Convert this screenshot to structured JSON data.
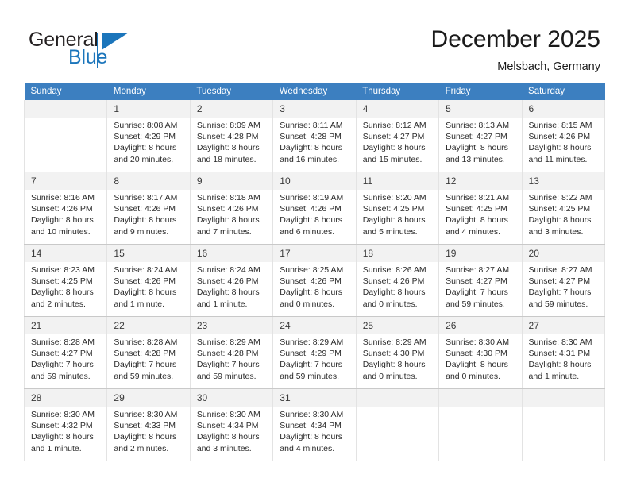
{
  "brand": {
    "name_top": "General",
    "name_bottom": "Blue",
    "accent_color": "#1b75bb",
    "text_color": "#231f20"
  },
  "header": {
    "title": "December 2025",
    "subtitle": "Melsbach, Germany",
    "header_bg_color": "#3c7fc0",
    "header_text_color": "#ffffff"
  },
  "weekday_headers": [
    "Sunday",
    "Monday",
    "Tuesday",
    "Wednesday",
    "Thursday",
    "Friday",
    "Saturday"
  ],
  "weeks": [
    [
      {
        "day": "",
        "sunrise": "",
        "sunset": "",
        "daylight_line1": "",
        "daylight_line2": ""
      },
      {
        "day": "1",
        "sunrise": "Sunrise: 8:08 AM",
        "sunset": "Sunset: 4:29 PM",
        "daylight_line1": "Daylight: 8 hours",
        "daylight_line2": "and 20 minutes."
      },
      {
        "day": "2",
        "sunrise": "Sunrise: 8:09 AM",
        "sunset": "Sunset: 4:28 PM",
        "daylight_line1": "Daylight: 8 hours",
        "daylight_line2": "and 18 minutes."
      },
      {
        "day": "3",
        "sunrise": "Sunrise: 8:11 AM",
        "sunset": "Sunset: 4:28 PM",
        "daylight_line1": "Daylight: 8 hours",
        "daylight_line2": "and 16 minutes."
      },
      {
        "day": "4",
        "sunrise": "Sunrise: 8:12 AM",
        "sunset": "Sunset: 4:27 PM",
        "daylight_line1": "Daylight: 8 hours",
        "daylight_line2": "and 15 minutes."
      },
      {
        "day": "5",
        "sunrise": "Sunrise: 8:13 AM",
        "sunset": "Sunset: 4:27 PM",
        "daylight_line1": "Daylight: 8 hours",
        "daylight_line2": "and 13 minutes."
      },
      {
        "day": "6",
        "sunrise": "Sunrise: 8:15 AM",
        "sunset": "Sunset: 4:26 PM",
        "daylight_line1": "Daylight: 8 hours",
        "daylight_line2": "and 11 minutes."
      }
    ],
    [
      {
        "day": "7",
        "sunrise": "Sunrise: 8:16 AM",
        "sunset": "Sunset: 4:26 PM",
        "daylight_line1": "Daylight: 8 hours",
        "daylight_line2": "and 10 minutes."
      },
      {
        "day": "8",
        "sunrise": "Sunrise: 8:17 AM",
        "sunset": "Sunset: 4:26 PM",
        "daylight_line1": "Daylight: 8 hours",
        "daylight_line2": "and 9 minutes."
      },
      {
        "day": "9",
        "sunrise": "Sunrise: 8:18 AM",
        "sunset": "Sunset: 4:26 PM",
        "daylight_line1": "Daylight: 8 hours",
        "daylight_line2": "and 7 minutes."
      },
      {
        "day": "10",
        "sunrise": "Sunrise: 8:19 AM",
        "sunset": "Sunset: 4:26 PM",
        "daylight_line1": "Daylight: 8 hours",
        "daylight_line2": "and 6 minutes."
      },
      {
        "day": "11",
        "sunrise": "Sunrise: 8:20 AM",
        "sunset": "Sunset: 4:25 PM",
        "daylight_line1": "Daylight: 8 hours",
        "daylight_line2": "and 5 minutes."
      },
      {
        "day": "12",
        "sunrise": "Sunrise: 8:21 AM",
        "sunset": "Sunset: 4:25 PM",
        "daylight_line1": "Daylight: 8 hours",
        "daylight_line2": "and 4 minutes."
      },
      {
        "day": "13",
        "sunrise": "Sunrise: 8:22 AM",
        "sunset": "Sunset: 4:25 PM",
        "daylight_line1": "Daylight: 8 hours",
        "daylight_line2": "and 3 minutes."
      }
    ],
    [
      {
        "day": "14",
        "sunrise": "Sunrise: 8:23 AM",
        "sunset": "Sunset: 4:25 PM",
        "daylight_line1": "Daylight: 8 hours",
        "daylight_line2": "and 2 minutes."
      },
      {
        "day": "15",
        "sunrise": "Sunrise: 8:24 AM",
        "sunset": "Sunset: 4:26 PM",
        "daylight_line1": "Daylight: 8 hours",
        "daylight_line2": "and 1 minute."
      },
      {
        "day": "16",
        "sunrise": "Sunrise: 8:24 AM",
        "sunset": "Sunset: 4:26 PM",
        "daylight_line1": "Daylight: 8 hours",
        "daylight_line2": "and 1 minute."
      },
      {
        "day": "17",
        "sunrise": "Sunrise: 8:25 AM",
        "sunset": "Sunset: 4:26 PM",
        "daylight_line1": "Daylight: 8 hours",
        "daylight_line2": "and 0 minutes."
      },
      {
        "day": "18",
        "sunrise": "Sunrise: 8:26 AM",
        "sunset": "Sunset: 4:26 PM",
        "daylight_line1": "Daylight: 8 hours",
        "daylight_line2": "and 0 minutes."
      },
      {
        "day": "19",
        "sunrise": "Sunrise: 8:27 AM",
        "sunset": "Sunset: 4:27 PM",
        "daylight_line1": "Daylight: 7 hours",
        "daylight_line2": "and 59 minutes."
      },
      {
        "day": "20",
        "sunrise": "Sunrise: 8:27 AM",
        "sunset": "Sunset: 4:27 PM",
        "daylight_line1": "Daylight: 7 hours",
        "daylight_line2": "and 59 minutes."
      }
    ],
    [
      {
        "day": "21",
        "sunrise": "Sunrise: 8:28 AM",
        "sunset": "Sunset: 4:27 PM",
        "daylight_line1": "Daylight: 7 hours",
        "daylight_line2": "and 59 minutes."
      },
      {
        "day": "22",
        "sunrise": "Sunrise: 8:28 AM",
        "sunset": "Sunset: 4:28 PM",
        "daylight_line1": "Daylight: 7 hours",
        "daylight_line2": "and 59 minutes."
      },
      {
        "day": "23",
        "sunrise": "Sunrise: 8:29 AM",
        "sunset": "Sunset: 4:28 PM",
        "daylight_line1": "Daylight: 7 hours",
        "daylight_line2": "and 59 minutes."
      },
      {
        "day": "24",
        "sunrise": "Sunrise: 8:29 AM",
        "sunset": "Sunset: 4:29 PM",
        "daylight_line1": "Daylight: 7 hours",
        "daylight_line2": "and 59 minutes."
      },
      {
        "day": "25",
        "sunrise": "Sunrise: 8:29 AM",
        "sunset": "Sunset: 4:30 PM",
        "daylight_line1": "Daylight: 8 hours",
        "daylight_line2": "and 0 minutes."
      },
      {
        "day": "26",
        "sunrise": "Sunrise: 8:30 AM",
        "sunset": "Sunset: 4:30 PM",
        "daylight_line1": "Daylight: 8 hours",
        "daylight_line2": "and 0 minutes."
      },
      {
        "day": "27",
        "sunrise": "Sunrise: 8:30 AM",
        "sunset": "Sunset: 4:31 PM",
        "daylight_line1": "Daylight: 8 hours",
        "daylight_line2": "and 1 minute."
      }
    ],
    [
      {
        "day": "28",
        "sunrise": "Sunrise: 8:30 AM",
        "sunset": "Sunset: 4:32 PM",
        "daylight_line1": "Daylight: 8 hours",
        "daylight_line2": "and 1 minute."
      },
      {
        "day": "29",
        "sunrise": "Sunrise: 8:30 AM",
        "sunset": "Sunset: 4:33 PM",
        "daylight_line1": "Daylight: 8 hours",
        "daylight_line2": "and 2 minutes."
      },
      {
        "day": "30",
        "sunrise": "Sunrise: 8:30 AM",
        "sunset": "Sunset: 4:34 PM",
        "daylight_line1": "Daylight: 8 hours",
        "daylight_line2": "and 3 minutes."
      },
      {
        "day": "31",
        "sunrise": "Sunrise: 8:30 AM",
        "sunset": "Sunset: 4:34 PM",
        "daylight_line1": "Daylight: 8 hours",
        "daylight_line2": "and 4 minutes."
      },
      {
        "day": "",
        "sunrise": "",
        "sunset": "",
        "daylight_line1": "",
        "daylight_line2": ""
      },
      {
        "day": "",
        "sunrise": "",
        "sunset": "",
        "daylight_line1": "",
        "daylight_line2": ""
      },
      {
        "day": "",
        "sunrise": "",
        "sunset": "",
        "daylight_line1": "",
        "daylight_line2": ""
      }
    ]
  ]
}
